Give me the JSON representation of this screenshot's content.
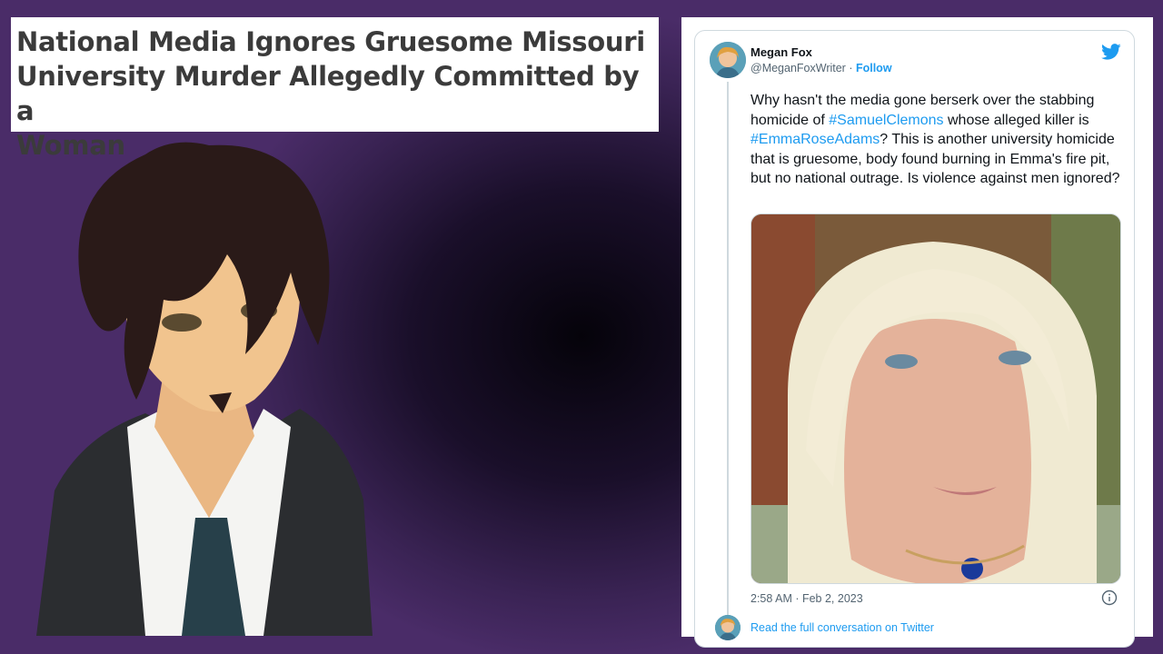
{
  "headline": {
    "line1": "National Media Ignores Gruesome Missouri",
    "line2": "University Murder Allegedly Committed by a",
    "line3": "Woman"
  },
  "tweet": {
    "author_name": "Megan Fox",
    "handle": "@MeganFoxWriter",
    "separator": " · ",
    "follow_label": "Follow",
    "text_part1": "Why hasn't the media gone berserk over the stabbing homicide of ",
    "hashtag1": "#SamuelClemons",
    "text_part2": " whose alleged killer is ",
    "hashtag2": "#EmmaRoseAdams",
    "text_part3": "? This is another university homicide that is gruesome, body found burning in Emma's fire pit, but no national outrage. Is violence against men ignored?",
    "timestamp": "2:58 AM · Feb 2, 2023",
    "read_more_label": "Read the full conversation on Twitter"
  },
  "colors": {
    "link": "#1d9bf0",
    "headline_text": "#3b3b3b",
    "background": "#3a2354"
  },
  "icons": {
    "brand": "twitter-bird-icon",
    "info": "info-icon"
  }
}
